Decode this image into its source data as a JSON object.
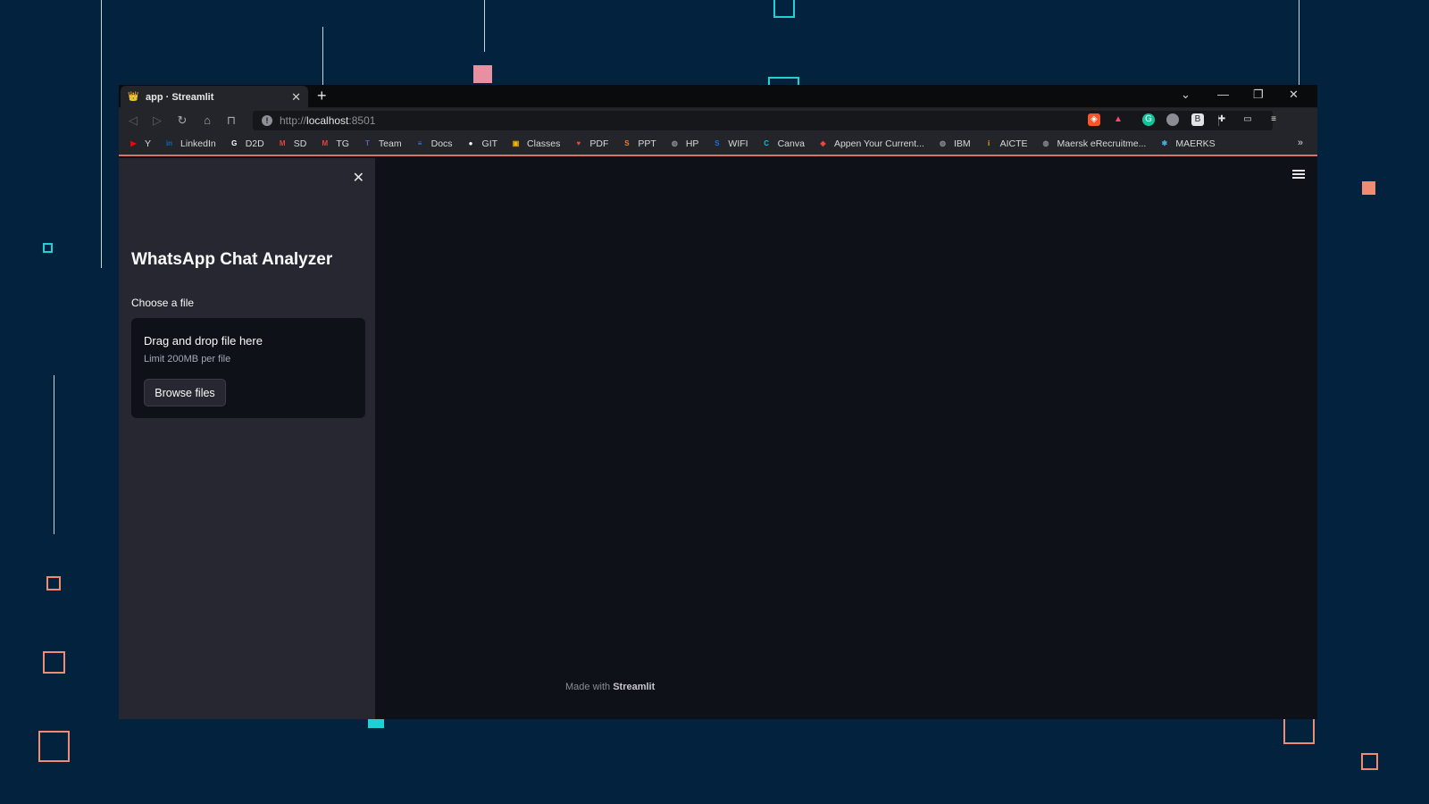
{
  "browser": {
    "tab_title": "app · Streamlit",
    "tab_close": "✕",
    "new_tab": "+",
    "url_protocol": "http://",
    "url_host": "localhost",
    "url_port": ":8501",
    "window_controls": {
      "dropdown": "⌄",
      "minimize": "—",
      "restore": "❐",
      "close": "✕"
    },
    "bookmarks": [
      {
        "label": "Y",
        "icon": "youtube-icon",
        "color": "#ff0000",
        "glyph": "▶"
      },
      {
        "label": "LinkedIn",
        "icon": "linkedin-icon",
        "color": "#0a66c2",
        "glyph": "in"
      },
      {
        "label": "D2D",
        "icon": "google-icon",
        "color": "#ffffff",
        "glyph": "G"
      },
      {
        "label": "SD",
        "icon": "gmail-icon",
        "color": "#ea4335",
        "glyph": "M"
      },
      {
        "label": "TG",
        "icon": "gmail-icon",
        "color": "#ea4335",
        "glyph": "M"
      },
      {
        "label": "Team",
        "icon": "teams-icon",
        "color": "#5b5fc7",
        "glyph": "T"
      },
      {
        "label": "Docs",
        "icon": "docs-icon",
        "color": "#4285f4",
        "glyph": "≡"
      },
      {
        "label": "GIT",
        "icon": "github-icon",
        "color": "#ffffff",
        "glyph": "●"
      },
      {
        "label": "Classes",
        "icon": "classroom-icon",
        "color": "#f4b400",
        "glyph": "▣"
      },
      {
        "label": "PDF",
        "icon": "pdf-icon",
        "color": "#e9473f",
        "glyph": "♥"
      },
      {
        "label": "PPT",
        "icon": "ppt-icon",
        "color": "#f58220",
        "glyph": "S"
      },
      {
        "label": "HP",
        "icon": "globe-icon",
        "color": "#8a8d93",
        "glyph": "◍"
      },
      {
        "label": "WIFI",
        "icon": "wifi-icon",
        "color": "#1a73e8",
        "glyph": "S"
      },
      {
        "label": "Canva",
        "icon": "canva-icon",
        "color": "#00c4cc",
        "glyph": "C"
      },
      {
        "label": "Appen Your Current...",
        "icon": "appen-icon",
        "color": "#e9473f",
        "glyph": "◆"
      },
      {
        "label": "IBM",
        "icon": "globe-icon",
        "color": "#8a8d93",
        "glyph": "◍"
      },
      {
        "label": "AICTE",
        "icon": "aicte-icon",
        "color": "#f4b400",
        "glyph": "i"
      },
      {
        "label": "Maersk eRecruitme...",
        "icon": "globe-icon",
        "color": "#8a8d93",
        "glyph": "◍"
      },
      {
        "label": "MAERKS",
        "icon": "maersk-icon",
        "color": "#42b0d5",
        "glyph": "✱"
      }
    ],
    "bookmarks_more": "»"
  },
  "sidebar": {
    "close": "✕",
    "title": "WhatsApp Chat Analyzer",
    "file_label": "Choose a file",
    "dropzone_title": "Drag and drop file here",
    "dropzone_limit": "Limit 200MB per file",
    "browse_button": "Browse files"
  },
  "footer": {
    "prefix": "Made with ",
    "brand": "Streamlit"
  },
  "colors": {
    "background": "#03223d",
    "accent_coral": "#f28b74",
    "accent_teal": "#1fd1d4",
    "accent_pink": "#e8909f"
  }
}
